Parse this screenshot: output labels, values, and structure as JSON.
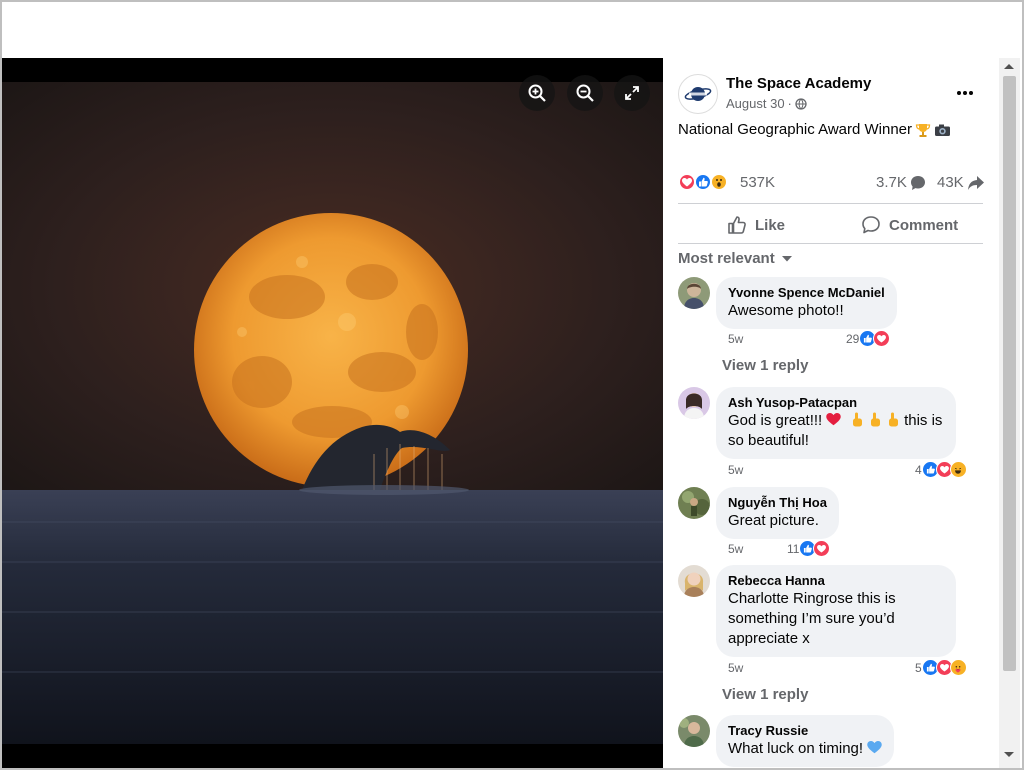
{
  "viewer": {
    "zoom_in_icon": "zoom-in-icon",
    "zoom_out_icon": "zoom-out-icon",
    "fullscreen_icon": "expand-icon"
  },
  "post": {
    "page_name": "The Space Academy",
    "date": "August 30",
    "date_separator": "·",
    "privacy_icon": "globe-icon",
    "caption": "National Geographic Award Winner",
    "caption_emojis": [
      "trophy-emoji",
      "camera-emoji"
    ],
    "reactions": [
      "love",
      "like",
      "wow"
    ],
    "reaction_count": "537K",
    "comment_count": "3.7K",
    "share_count": "43K",
    "like_label": "Like",
    "comment_label": "Comment",
    "filter_label": "Most relevant"
  },
  "comments": [
    {
      "name": "Yvonne Spence McDaniel",
      "text": [
        "Awesome photo!!"
      ],
      "time": "5w",
      "react_count": "29",
      "reactions": [
        "like",
        "love"
      ],
      "reply_label": "View 1 reply"
    },
    {
      "name": "Ash Yusop-Patacpan",
      "text": [
        "God is great!!! ",
        " this is",
        "so beautiful!"
      ],
      "time": "5w",
      "react_count": "4",
      "reactions": [
        "like",
        "love",
        "haha"
      ]
    },
    {
      "name": "Nguyễn Thị Hoa",
      "text": [
        "Great picture."
      ],
      "time": "5w",
      "react_count": "11",
      "reactions": [
        "like",
        "love"
      ]
    },
    {
      "name": "Rebecca Hanna",
      "text": [
        "Charlotte Ringrose this is",
        "something I’m sure you’d",
        "appreciate x"
      ],
      "time": "5w",
      "react_count": "5",
      "reactions": [
        "like",
        "love",
        "care"
      ],
      "reply_label": "View 1 reply"
    },
    {
      "name": "Tracy Russie",
      "text": [
        "What luck on timing! "
      ]
    }
  ],
  "colors": {
    "like_blue": "#1877f2",
    "love_red": "#f33e58",
    "wow_yellow": "#f7b125",
    "muted_text": "#65676b",
    "bubble_bg": "#f0f2f5",
    "moon_orange": "#f2a23a",
    "sky_dark": "#2a1d1c",
    "sea_dark": "#1c2233"
  }
}
